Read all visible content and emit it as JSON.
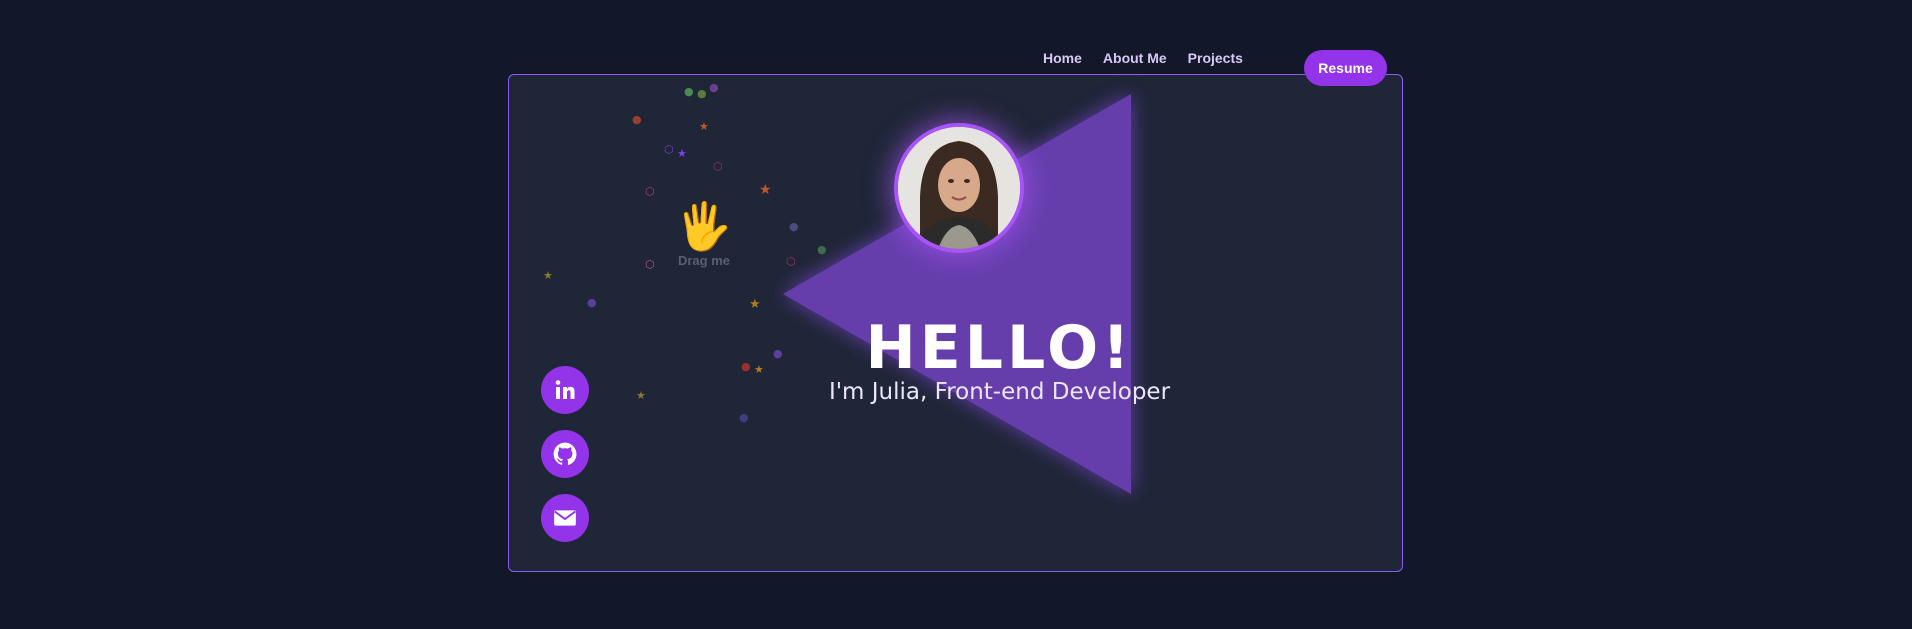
{
  "nav": {
    "items": [
      {
        "label": "Home"
      },
      {
        "label": "About Me"
      },
      {
        "label": "Projects"
      }
    ],
    "resume_label": "Resume"
  },
  "hero": {
    "greeting": "HELLO!",
    "subtitle": "I'm Julia, Front-end Developer",
    "drag_label": "Drag me",
    "hand_emoji": "🖐"
  },
  "socials": [
    {
      "icon": "linkedin-icon"
    },
    {
      "icon": "github-icon"
    },
    {
      "icon": "mail-icon"
    }
  ],
  "colors": {
    "background": "#121829",
    "card": "#1f2637",
    "accent": "#9333ea",
    "triangle": "#6b3fb3",
    "nav_text": "#d7c8f5"
  }
}
